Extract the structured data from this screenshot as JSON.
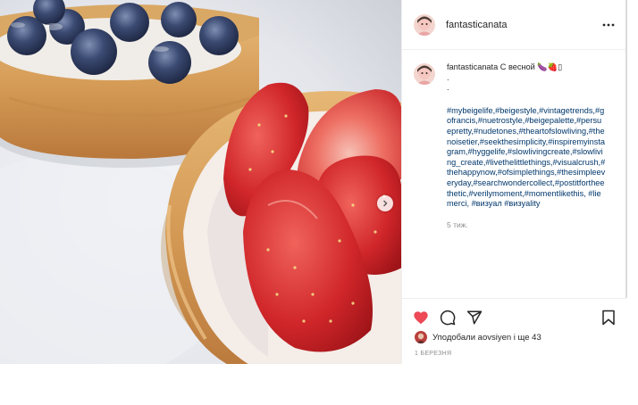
{
  "post": {
    "username": "fantasticanata",
    "caption_user": "fantasticanata",
    "caption_text": "С весной 🍆🍓▯",
    "caption_dot1": ".",
    "caption_dot2": ".",
    "hashtags": "#mybeigelife,#beigestyle,#vintagetrends,#gofrancis,#nuetrostyle,#beigepalette,#persuepretty,#nudetones,#theartofslowliving,#thenoisetier,#seekthesimplicity,#inspiremyinstagram,#hyggelife,#slowlivingcreate,#slowliving_create,#livethelittlethings,#visualcrush,#thehappynow,#ofsimplethings,#thesimpleeveryday,#searchwondercollect,#postitfortheethetic,#verilymoment,#momentlikethis, #liemerci, #визуал #визуality",
    "time_ago": "5 тиж.",
    "likes_prefix": "Уподобали",
    "likes_user": "aovsiyen",
    "likes_suffix": "і ще 43",
    "date": "1 БЕРЕЗНЯ"
  },
  "icons": {
    "more": "more-dots-icon",
    "like": "heart-icon",
    "comment": "comment-icon",
    "share": "share-icon",
    "save": "bookmark-icon",
    "carousel_next": "chevron-right-icon"
  },
  "colors": {
    "like_red": "#ed4956",
    "hashtag_blue": "#00376b",
    "muted_gray": "#8e8e8e"
  }
}
